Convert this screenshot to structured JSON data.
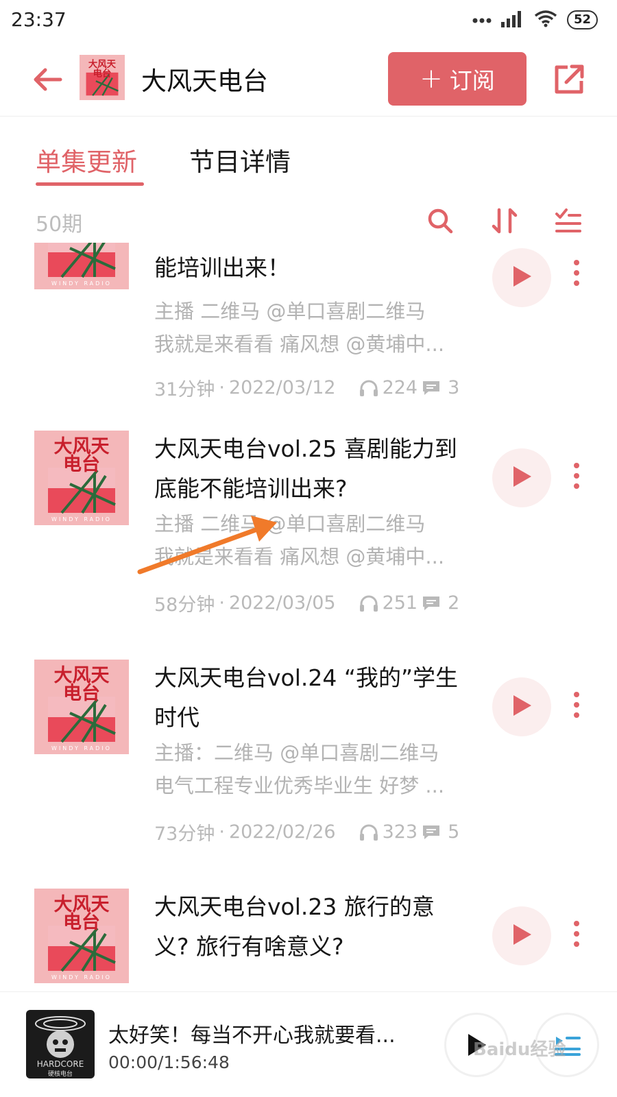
{
  "status_bar": {
    "time": "23:37",
    "battery": "52"
  },
  "header": {
    "title": "大风天电台",
    "subscribe_plus": "+",
    "subscribe_label": "订阅"
  },
  "tabs": [
    {
      "label": "单集更新",
      "active": true
    },
    {
      "label": "节目详情",
      "active": false
    }
  ],
  "toolbar": {
    "episode_count": "50期"
  },
  "episodes": [
    {
      "title": "能培训出来！",
      "desc_line1": "主播 二维马 @单口喜剧二维马",
      "desc_line2": "我就是来看看 痛风想 @黄埔中...",
      "duration": "31分钟",
      "date": "2022/03/12",
      "plays": "224",
      "comments": "3"
    },
    {
      "title": "大风天电台vol.25 喜剧能力到底能不能培训出来?",
      "desc_line1": "主播 二维马 @单口喜剧二维马",
      "desc_line2": "我就是来看看 痛风想 @黄埔中...",
      "duration": "58分钟",
      "date": "2022/03/05",
      "plays": "251",
      "comments": "2"
    },
    {
      "title": "大风天电台vol.24 “我的”学生时代",
      "desc_line1": "主播：二维马 @单口喜剧二维马",
      "desc_line2": "电气工程专业优秀毕业生 好梦 ...",
      "duration": "73分钟",
      "date": "2022/02/26",
      "plays": "323",
      "comments": "5"
    },
    {
      "title": "大风天电台vol.23 旅行的意义? 旅行有啥意义?",
      "desc_line1": "",
      "desc_line2": "",
      "duration": "",
      "date": "",
      "plays": "",
      "comments": ""
    }
  ],
  "cover_art": {
    "text_line1": "大风天",
    "text_line2": "电台",
    "footer": "WINDY RADIO"
  },
  "player": {
    "title": "太好笑！每当不开心我就要看...",
    "time": "00:00/1:56:48",
    "cover_text_top": "HARDCORE",
    "cover_text_bottom": "硬核电台"
  },
  "watermark": "Baidu经验",
  "colors": {
    "accent": "#e06368",
    "muted_text": "#b3b3b3",
    "play_bg": "#fbeeee",
    "annotation_arrow": "#f07a2a"
  }
}
